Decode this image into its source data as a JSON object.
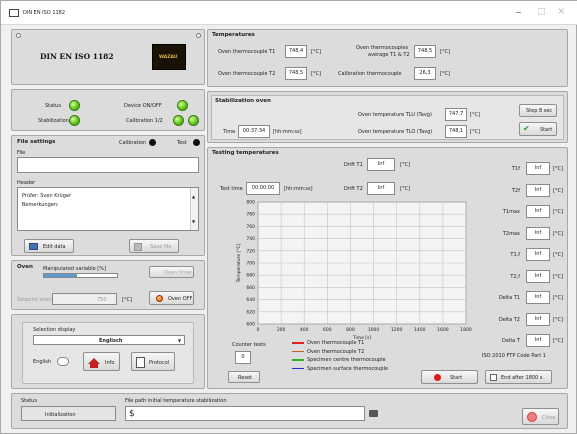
{
  "window": {
    "title": "DIN EN ISO 1182",
    "min": "−",
    "max": "□",
    "close": "×"
  },
  "logo": {
    "title": "DIN EN ISO 1182",
    "brand": "WAZAU"
  },
  "temperatures": {
    "title": "Temperatures",
    "oven_t1_label": "Oven thermocouple T1",
    "oven_t1_value": "748,4",
    "oven_t1_unit": "[°C]",
    "oven_t2_label": "Oven thermocouple T2",
    "oven_t2_value": "748,5",
    "oven_t2_unit": "[°C]",
    "avg_label_1": "Oven thermocouples",
    "avg_label_2": "average  T1 & T2",
    "avg_value": "748,5",
    "avg_unit": "[°C]",
    "cal_label": "Calibration thermocouple",
    "cal_value": "26,3",
    "cal_unit": "[°C]"
  },
  "status_panel": {
    "status": "Status",
    "device": "Device ON/OFF",
    "stabilization": "Stabilization",
    "calibration": "Calibration 1/2"
  },
  "file_settings": {
    "title": "File settings",
    "calibration": "Calibration",
    "test": "Test",
    "file": "File",
    "file_value": "",
    "header": "Header",
    "header_lines": [
      "Prüfer: Sven Krüger",
      "Bemerkungen:"
    ],
    "edit_data": "Edit data",
    "save_file": "Save file"
  },
  "oven": {
    "title": "Oven",
    "manip_label": "Manipulated variable [%]",
    "manip_value": "45",
    "setpoint_label": "Setpoint oven",
    "setpoint_value": "750",
    "setpoint_unit": "[°C]",
    "oven_timer": "Oven timer",
    "oven_off": "Oven OFF"
  },
  "display": {
    "label": "Selection display",
    "selected": "Englisch",
    "english": "English",
    "info": "Info",
    "protocol": "Protocol"
  },
  "stab": {
    "title": "Stabilization oven",
    "time_label": "Time",
    "time_value": "00:37:34",
    "time_unit": "[hh:mm:ss]",
    "tlu_label": "Oven temperature TLU (Tavg)",
    "tlu_value": "747,7",
    "tlu_unit": "[°C]",
    "tlo_label": "Oven temperature TLO (Tavg)",
    "tlo_value": "748,1",
    "tlo_unit": "[°C]",
    "step_button": "Step 8 sec",
    "start_button": "Start"
  },
  "testing": {
    "title": "Testing temperatures",
    "t1_label": "Drift T1",
    "t1_value": "Inf",
    "t1_unit": "[°C]",
    "tt_label": "Test time",
    "tt_value": "00:00:00",
    "tt_unit": "[hh:mm:ss]",
    "t2_label": "Drift T2",
    "t2_value": "Inf",
    "t2_unit": "[°C]",
    "right": [
      {
        "label": "T1f",
        "value": "Inf",
        "unit": "[°C]"
      },
      {
        "label": "T2f",
        "value": "Inf",
        "unit": "[°C]"
      },
      {
        "label": "T1max",
        "value": "Inf",
        "unit": "[°C]"
      },
      {
        "label": "T2max",
        "value": "Inf",
        "unit": "[°C]"
      },
      {
        "label": "T1,f",
        "value": "Inf",
        "unit": "[°C]"
      },
      {
        "label": "T2,f",
        "value": "Inf",
        "unit": "[°C]"
      },
      {
        "label": "Delta T1",
        "value": "Inf",
        "unit": "[°C]"
      },
      {
        "label": "Delta T2",
        "value": "Inf",
        "unit": "[°C]"
      },
      {
        "label": "Delta T",
        "value": "Inf",
        "unit": "[°C]"
      }
    ],
    "counter_label": "Counter tests",
    "counter_value": "0",
    "reset": "Reset",
    "iso_label": "ISO 2010 FTP Code Part 1",
    "start": "Start",
    "end_after": "End after 1800 s"
  },
  "chart_data": {
    "type": "line",
    "xlabel": "Time [s]",
    "ylabel": "Temperature [°C]",
    "xlim": [
      0,
      1800
    ],
    "ylim": [
      600,
      800
    ],
    "x_ticks": [
      "0",
      "200",
      "400",
      "600",
      "800",
      "1000",
      "1200",
      "1400",
      "1600",
      "1800"
    ],
    "y_ticks": [
      "800",
      "780",
      "760",
      "740",
      "720",
      "700",
      "680",
      "660",
      "640",
      "620",
      "600"
    ],
    "grid": true,
    "legend_placement": "bottom",
    "series": [
      {
        "name": "Oven thermocouple T1",
        "color": "#e02020",
        "values": []
      },
      {
        "name": "Oven thermocouple T2",
        "color": "#c06020",
        "values": []
      },
      {
        "name": "Specimen centre thermocouple",
        "color": "#30b020",
        "values": []
      },
      {
        "name": "Specimen surface thermocouple",
        "color": "#2030d0",
        "values": []
      }
    ]
  },
  "statusbar": {
    "status_label": "Status",
    "status_value": "Initialization",
    "path_label": "File path initial temperature stabilization",
    "path_value": "",
    "close": "Close"
  }
}
